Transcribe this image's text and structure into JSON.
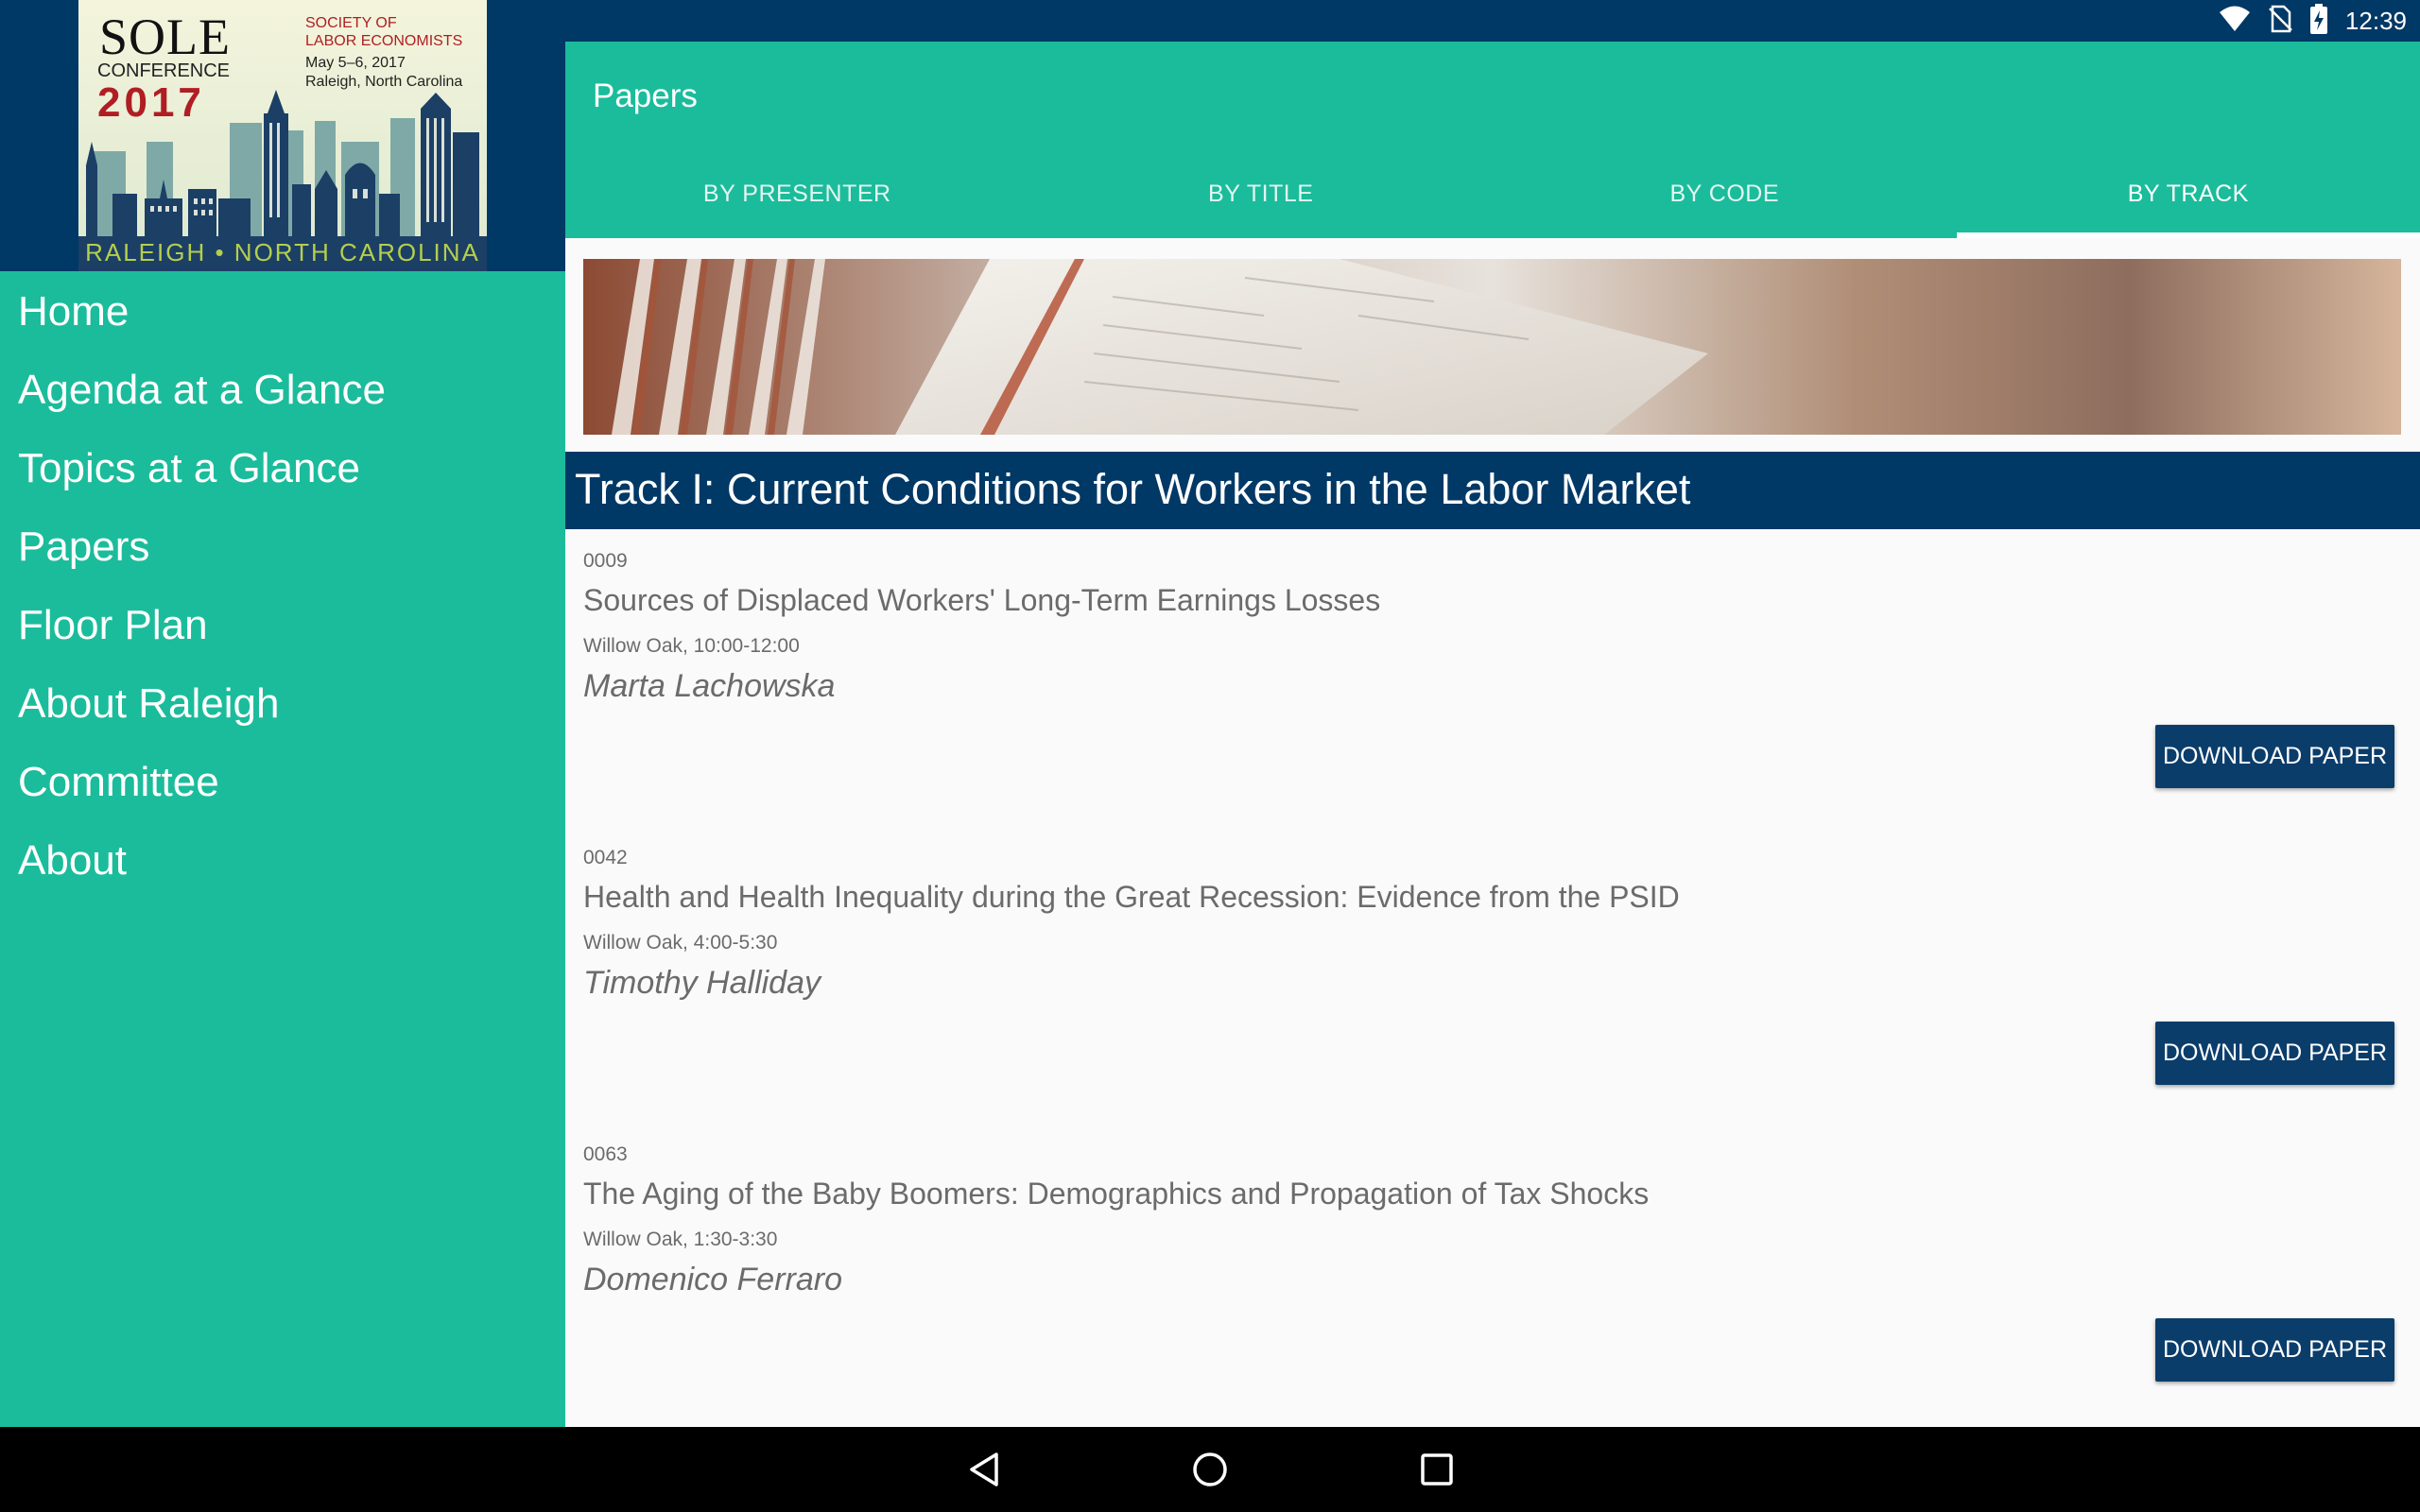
{
  "status_bar": {
    "time": "12:39"
  },
  "logo": {
    "sole": "SOLE",
    "conference": "CONFERENCE",
    "year": "2017",
    "society_line1": "SOCIETY OF",
    "society_line2": "LABOR ECONOMISTS",
    "dates": "May 5–6, 2017",
    "place": "Raleigh, North Carolina",
    "region": "RALEIGH • NORTH CAROLINA"
  },
  "nav": {
    "items": [
      {
        "label": "Home"
      },
      {
        "label": "Agenda at a Glance"
      },
      {
        "label": "Topics at a Glance"
      },
      {
        "label": "Papers"
      },
      {
        "label": "Floor Plan"
      },
      {
        "label": "About Raleigh"
      },
      {
        "label": "Committee"
      },
      {
        "label": "About"
      }
    ]
  },
  "appbar": {
    "title": "Papers",
    "tabs": [
      {
        "label": "BY PRESENTER"
      },
      {
        "label": "BY TITLE"
      },
      {
        "label": "BY CODE"
      },
      {
        "label": "BY TRACK"
      }
    ],
    "active_tab": "BY TRACK"
  },
  "track": {
    "title": "Track I: Current Conditions for Workers in the Labor Market"
  },
  "papers": [
    {
      "code": "0009",
      "title": "Sources of Displaced Workers' Long-Term Earnings Losses",
      "room": "Willow Oak, 10:00-12:00",
      "author": "Marta Lachowska",
      "button": "DOWNLOAD PAPER"
    },
    {
      "code": "0042",
      "title": "Health and Health Inequality during the Great Recession: Evidence from the PSID",
      "room": "Willow Oak, 4:00-5:30",
      "author": "Timothy Halliday",
      "button": "DOWNLOAD PAPER"
    },
    {
      "code": "0063",
      "title": "The Aging of the Baby Boomers: Demographics and Propagation of Tax Shocks",
      "room": "Willow Oak, 1:30-3:30",
      "author": "Domenico Ferraro",
      "button": "DOWNLOAD PAPER"
    }
  ],
  "colors": {
    "teal": "#1bbc9b",
    "navy": "#003866",
    "button": "#0b3d6b"
  },
  "icons": {
    "status": [
      "wifi-icon",
      "no-sim-icon",
      "battery-charging-icon"
    ],
    "navbar": [
      "back-icon",
      "home-icon",
      "recents-icon"
    ]
  }
}
